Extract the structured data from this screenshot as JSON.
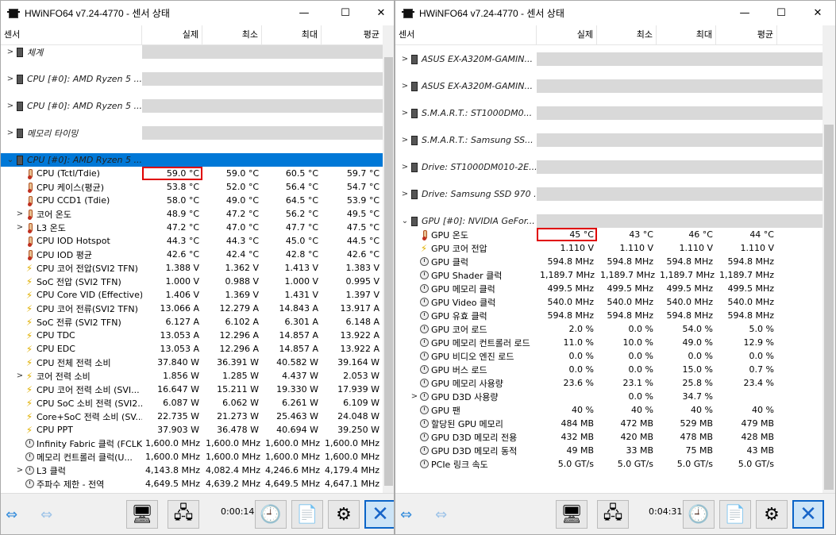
{
  "left": {
    "title": "HWiNFO64 v7.24-4770 - 센서 상태",
    "headers": [
      "센서",
      "실제",
      "최소",
      "최대",
      "평균"
    ],
    "groups": [
      {
        "label": "체계",
        "selected": false
      },
      {
        "label": "CPU [#0]: AMD Ryzen 5 ...",
        "selected": false
      },
      {
        "label": "CPU [#0]: AMD Ryzen 5 ...",
        "selected": false
      },
      {
        "label": "메모리 타이밍",
        "selected": false
      }
    ],
    "open_group": {
      "label": "CPU [#0]: AMD Ryzen 5 ..."
    },
    "rows": [
      {
        "icon": "thermometer-icon",
        "exp": "",
        "label": "CPU (Tctl/Tdie)",
        "cur": "59.0 °C",
        "min": "59.0 °C",
        "max": "60.5 °C",
        "avg": "59.7 °C",
        "hl": true
      },
      {
        "icon": "thermometer-icon",
        "exp": "",
        "label": "CPU 케이스(평균)",
        "cur": "53.8 °C",
        "min": "52.0 °C",
        "max": "56.4 °C",
        "avg": "54.7 °C"
      },
      {
        "icon": "thermometer-icon",
        "exp": "",
        "label": "CPU CCD1 (Tdie)",
        "cur": "58.0 °C",
        "min": "49.0 °C",
        "max": "64.5 °C",
        "avg": "53.9 °C"
      },
      {
        "icon": "thermometer-icon",
        "exp": ">",
        "label": "코어 온도",
        "cur": "48.9 °C",
        "min": "47.2 °C",
        "max": "56.2 °C",
        "avg": "49.5 °C"
      },
      {
        "icon": "thermometer-icon",
        "exp": ">",
        "label": "L3 온도",
        "cur": "47.2 °C",
        "min": "47.0 °C",
        "max": "47.7 °C",
        "avg": "47.5 °C"
      },
      {
        "icon": "thermometer-icon",
        "exp": "",
        "label": "CPU IOD Hotspot",
        "cur": "44.3 °C",
        "min": "44.3 °C",
        "max": "45.0 °C",
        "avg": "44.5 °C"
      },
      {
        "icon": "thermometer-icon",
        "exp": "",
        "label": "CPU IOD 평균",
        "cur": "42.6 °C",
        "min": "42.4 °C",
        "max": "42.8 °C",
        "avg": "42.6 °C"
      },
      {
        "icon": "bolt-icon",
        "exp": "",
        "label": "CPU 코어 전압(SVI2 TFN)",
        "cur": "1.388 V",
        "min": "1.362 V",
        "max": "1.413 V",
        "avg": "1.383 V"
      },
      {
        "icon": "bolt-icon",
        "exp": "",
        "label": "SoC 전압 (SVI2 TFN)",
        "cur": "1.000 V",
        "min": "0.988 V",
        "max": "1.000 V",
        "avg": "0.995 V"
      },
      {
        "icon": "bolt-icon",
        "exp": "",
        "label": "CPU Core VID (Effective)",
        "cur": "1.406 V",
        "min": "1.369 V",
        "max": "1.431 V",
        "avg": "1.397 V"
      },
      {
        "icon": "bolt-icon",
        "exp": "",
        "label": "CPU 코어 전류(SVI2 TFN)",
        "cur": "13.066 A",
        "min": "12.279 A",
        "max": "14.843 A",
        "avg": "13.917 A"
      },
      {
        "icon": "bolt-icon",
        "exp": "",
        "label": "SoC 전류 (SVI2 TFN)",
        "cur": "6.127 A",
        "min": "6.102 A",
        "max": "6.301 A",
        "avg": "6.148 A"
      },
      {
        "icon": "bolt-icon",
        "exp": "",
        "label": "CPU TDC",
        "cur": "13.053 A",
        "min": "12.296 A",
        "max": "14.857 A",
        "avg": "13.922 A"
      },
      {
        "icon": "bolt-icon",
        "exp": "",
        "label": "CPU EDC",
        "cur": "13.053 A",
        "min": "12.296 A",
        "max": "14.857 A",
        "avg": "13.922 A"
      },
      {
        "icon": "bolt-icon",
        "exp": "",
        "label": "CPU 전체 전력 소비",
        "cur": "37.840 W",
        "min": "36.391 W",
        "max": "40.582 W",
        "avg": "39.164 W"
      },
      {
        "icon": "bolt-icon",
        "exp": ">",
        "label": "코어 전력 소비",
        "cur": "1.856 W",
        "min": "1.285 W",
        "max": "4.437 W",
        "avg": "2.053 W"
      },
      {
        "icon": "bolt-icon",
        "exp": "",
        "label": "CPU 코어 전력 소비 (SVI...",
        "cur": "16.647 W",
        "min": "15.211 W",
        "max": "19.330 W",
        "avg": "17.939 W"
      },
      {
        "icon": "bolt-icon",
        "exp": "",
        "label": "CPU SoC 소비 전력 (SVI2...",
        "cur": "6.087 W",
        "min": "6.062 W",
        "max": "6.261 W",
        "avg": "6.109 W"
      },
      {
        "icon": "bolt-icon",
        "exp": "",
        "label": "Core+SoC 전력 소비 (SV...",
        "cur": "22.735 W",
        "min": "21.273 W",
        "max": "25.463 W",
        "avg": "24.048 W"
      },
      {
        "icon": "bolt-icon",
        "exp": "",
        "label": "CPU PPT",
        "cur": "37.903 W",
        "min": "36.478 W",
        "max": "40.694 W",
        "avg": "39.250 W"
      },
      {
        "icon": "clock-icon",
        "exp": "",
        "label": "Infinity Fabric 클럭 (FCLK)",
        "cur": "1,600.0 MHz",
        "min": "1,600.0 MHz",
        "max": "1,600.0 MHz",
        "avg": "1,600.0 MHz"
      },
      {
        "icon": "clock-icon",
        "exp": "",
        "label": "메모리 컨트롤러 클럭(U...",
        "cur": "1,600.0 MHz",
        "min": "1,600.0 MHz",
        "max": "1,600.0 MHz",
        "avg": "1,600.0 MHz"
      },
      {
        "icon": "clock-icon",
        "exp": ">",
        "label": "L3 클럭",
        "cur": "4,143.8 MHz",
        "min": "4,082.4 MHz",
        "max": "4,246.6 MHz",
        "avg": "4,179.4 MHz"
      },
      {
        "icon": "clock-icon",
        "exp": "",
        "label": "주파수 제한 - 전역",
        "cur": "4,649.5 MHz",
        "min": "4,639.2 MHz",
        "max": "4,649.5 MHz",
        "avg": "4,647.1 MHz"
      }
    ],
    "timer": "0:00:14"
  },
  "right": {
    "title": "HWiNFO64 v7.24-4770 - 센서 상태",
    "headers": [
      "센서",
      "실제",
      "최소",
      "최대",
      "평균"
    ],
    "groups": [
      {
        "label": "ASUS EX-A320M-GAMIN..."
      },
      {
        "label": "ASUS EX-A320M-GAMIN..."
      },
      {
        "label": "S.M.A.R.T.: ST1000DM0..."
      },
      {
        "label": "S.M.A.R.T.: Samsung SS..."
      },
      {
        "label": "Drive: ST1000DM010-2E..."
      },
      {
        "label": "Drive: Samsung SSD 970 ..."
      }
    ],
    "open_group": {
      "label": "GPU [#0]: NVIDIA GeFor..."
    },
    "rows": [
      {
        "icon": "thermometer-icon",
        "exp": "",
        "label": "GPU 온도",
        "cur": "45 °C",
        "min": "43 °C",
        "max": "46 °C",
        "avg": "44 °C",
        "hl": true
      },
      {
        "icon": "bolt-icon",
        "exp": "",
        "label": "GPU 코어 전압",
        "cur": "1.110 V",
        "min": "1.110 V",
        "max": "1.110 V",
        "avg": "1.110 V"
      },
      {
        "icon": "clock-icon",
        "exp": "",
        "label": "GPU 클럭",
        "cur": "594.8 MHz",
        "min": "594.8 MHz",
        "max": "594.8 MHz",
        "avg": "594.8 MHz"
      },
      {
        "icon": "clock-icon",
        "exp": "",
        "label": "GPU Shader 클럭",
        "cur": "1,189.7 MHz",
        "min": "1,189.7 MHz",
        "max": "1,189.7 MHz",
        "avg": "1,189.7 MHz"
      },
      {
        "icon": "clock-icon",
        "exp": "",
        "label": "GPU 메모리 클럭",
        "cur": "499.5 MHz",
        "min": "499.5 MHz",
        "max": "499.5 MHz",
        "avg": "499.5 MHz"
      },
      {
        "icon": "clock-icon",
        "exp": "",
        "label": "GPU Video 클럭",
        "cur": "540.0 MHz",
        "min": "540.0 MHz",
        "max": "540.0 MHz",
        "avg": "540.0 MHz"
      },
      {
        "icon": "clock-icon",
        "exp": "",
        "label": "GPU 유효 클럭",
        "cur": "594.8 MHz",
        "min": "594.8 MHz",
        "max": "594.8 MHz",
        "avg": "594.8 MHz"
      },
      {
        "icon": "clock-icon",
        "exp": "",
        "label": "GPU 코어 로드",
        "cur": "2.0 %",
        "min": "0.0 %",
        "max": "54.0 %",
        "avg": "5.0 %"
      },
      {
        "icon": "clock-icon",
        "exp": "",
        "label": "GPU 메모리 컨트롤러 로드",
        "cur": "11.0 %",
        "min": "10.0 %",
        "max": "49.0 %",
        "avg": "12.9 %"
      },
      {
        "icon": "clock-icon",
        "exp": "",
        "label": "GPU 비디오 엔진 로드",
        "cur": "0.0 %",
        "min": "0.0 %",
        "max": "0.0 %",
        "avg": "0.0 %"
      },
      {
        "icon": "clock-icon",
        "exp": "",
        "label": "GPU 버스 로드",
        "cur": "0.0 %",
        "min": "0.0 %",
        "max": "15.0 %",
        "avg": "0.7 %"
      },
      {
        "icon": "clock-icon",
        "exp": "",
        "label": "GPU 메모리 사용량",
        "cur": "23.6 %",
        "min": "23.1 %",
        "max": "25.8 %",
        "avg": "23.4 %"
      },
      {
        "icon": "clock-icon",
        "exp": ">",
        "label": "GPU D3D 사용량",
        "cur": "",
        "min": "0.0 %",
        "max": "34.7 %",
        "avg": ""
      },
      {
        "icon": "clock-icon",
        "exp": "",
        "label": "GPU 팬",
        "cur": "40 %",
        "min": "40 %",
        "max": "40 %",
        "avg": "40 %"
      },
      {
        "icon": "clock-icon",
        "exp": "",
        "label": "할당된 GPU 메모리",
        "cur": "484 MB",
        "min": "472 MB",
        "max": "529 MB",
        "avg": "479 MB"
      },
      {
        "icon": "clock-icon",
        "exp": "",
        "label": "GPU D3D 메모리 전용",
        "cur": "432 MB",
        "min": "420 MB",
        "max": "478 MB",
        "avg": "428 MB"
      },
      {
        "icon": "clock-icon",
        "exp": "",
        "label": "GPU D3D 메모리 동적",
        "cur": "49 MB",
        "min": "33 MB",
        "max": "75 MB",
        "avg": "43 MB"
      },
      {
        "icon": "clock-icon",
        "exp": "",
        "label": "PCIe 링크 속도",
        "cur": "5.0 GT/s",
        "min": "5.0 GT/s",
        "max": "5.0 GT/s",
        "avg": "5.0 GT/s"
      }
    ],
    "timer": "0:04:31"
  },
  "window_controls": {
    "minimize": "—",
    "maximize": "☐",
    "close": "✕"
  }
}
